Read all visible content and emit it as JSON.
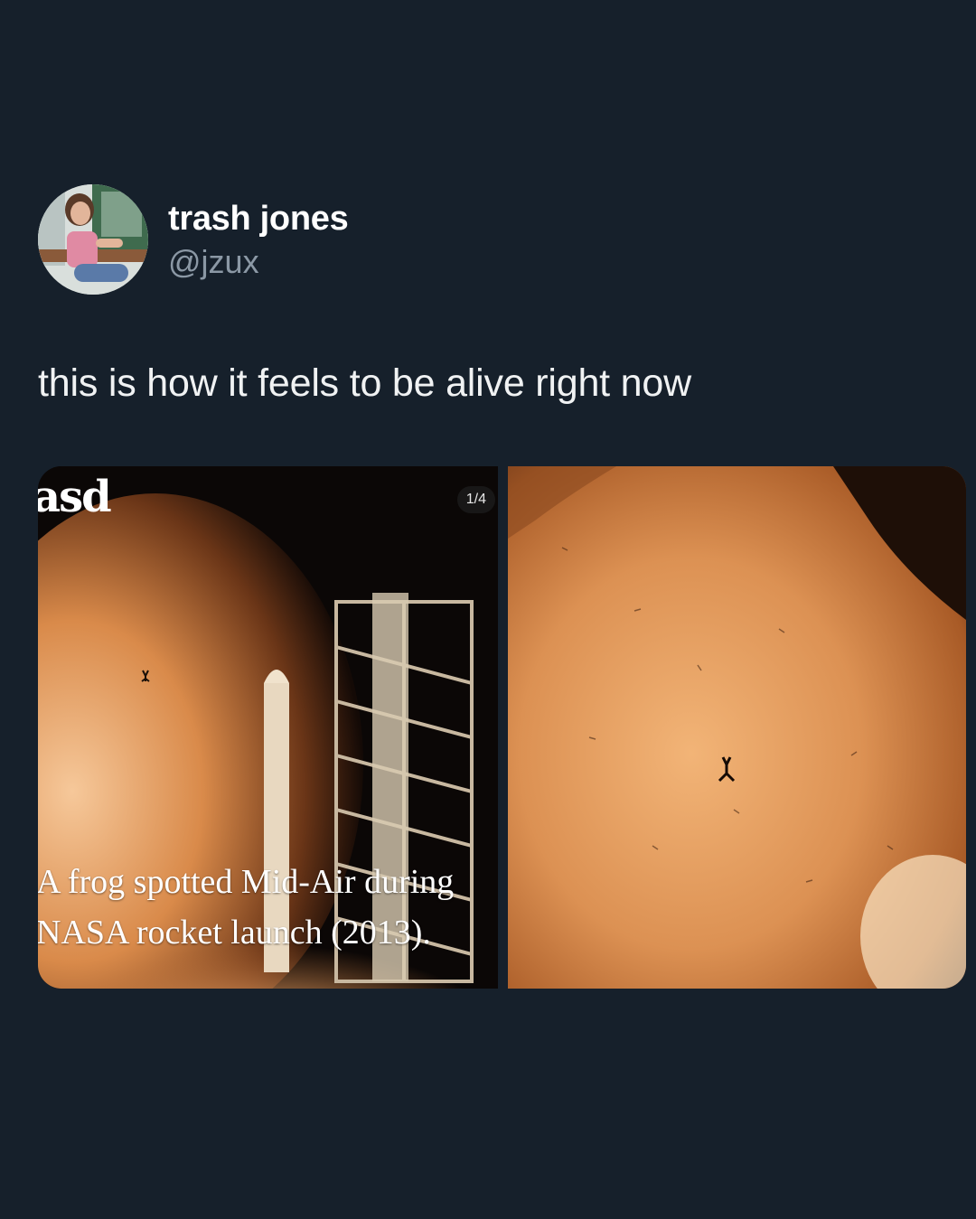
{
  "tweet": {
    "author": {
      "display_name": "trash jones",
      "handle": "@jzux"
    },
    "text": "this is how it feels to be alive right now"
  },
  "media": {
    "counter": "1/4",
    "image1": {
      "logo_text": "asd",
      "caption_lines": [
        "A frog spotted Mid-Air during",
        "NASA rocket launch (2013)."
      ]
    }
  },
  "colors": {
    "background": "#16202b",
    "display_name": "#ffffff",
    "handle": "#8b98a5",
    "text": "#f0f2f3"
  }
}
